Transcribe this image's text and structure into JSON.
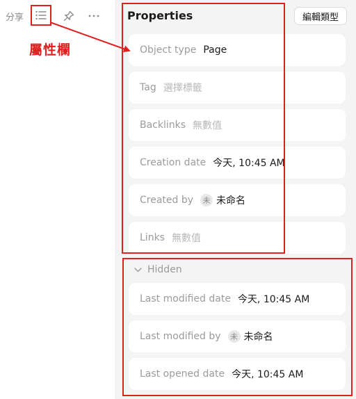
{
  "toolbar": {
    "share_label": "分享",
    "icons": [
      "properties-list-icon",
      "pin-icon",
      "more-icon"
    ]
  },
  "annotation": {
    "label": "屬性欄",
    "color": "#e02020"
  },
  "panel": {
    "title": "Properties",
    "edit_type_label": "編輯類型",
    "rows": [
      {
        "key": "Object type",
        "value": "Page"
      },
      {
        "key": "Tag",
        "placeholder": "選擇標籤"
      },
      {
        "key": "Backlinks",
        "placeholder": "無數值"
      },
      {
        "key": "Creation date",
        "value": "今天, 10:45 AM"
      },
      {
        "key": "Created by",
        "avatar": "未",
        "value": "未命名"
      },
      {
        "key": "Links",
        "placeholder": "無數值"
      }
    ],
    "hidden": {
      "label": "Hidden",
      "rows": [
        {
          "key": "Last modified date",
          "value": "今天, 10:45 AM"
        },
        {
          "key": "Last modified by",
          "avatar": "未",
          "value": "未命名"
        },
        {
          "key": "Last opened date",
          "value": "今天, 10:45 AM"
        }
      ]
    }
  }
}
